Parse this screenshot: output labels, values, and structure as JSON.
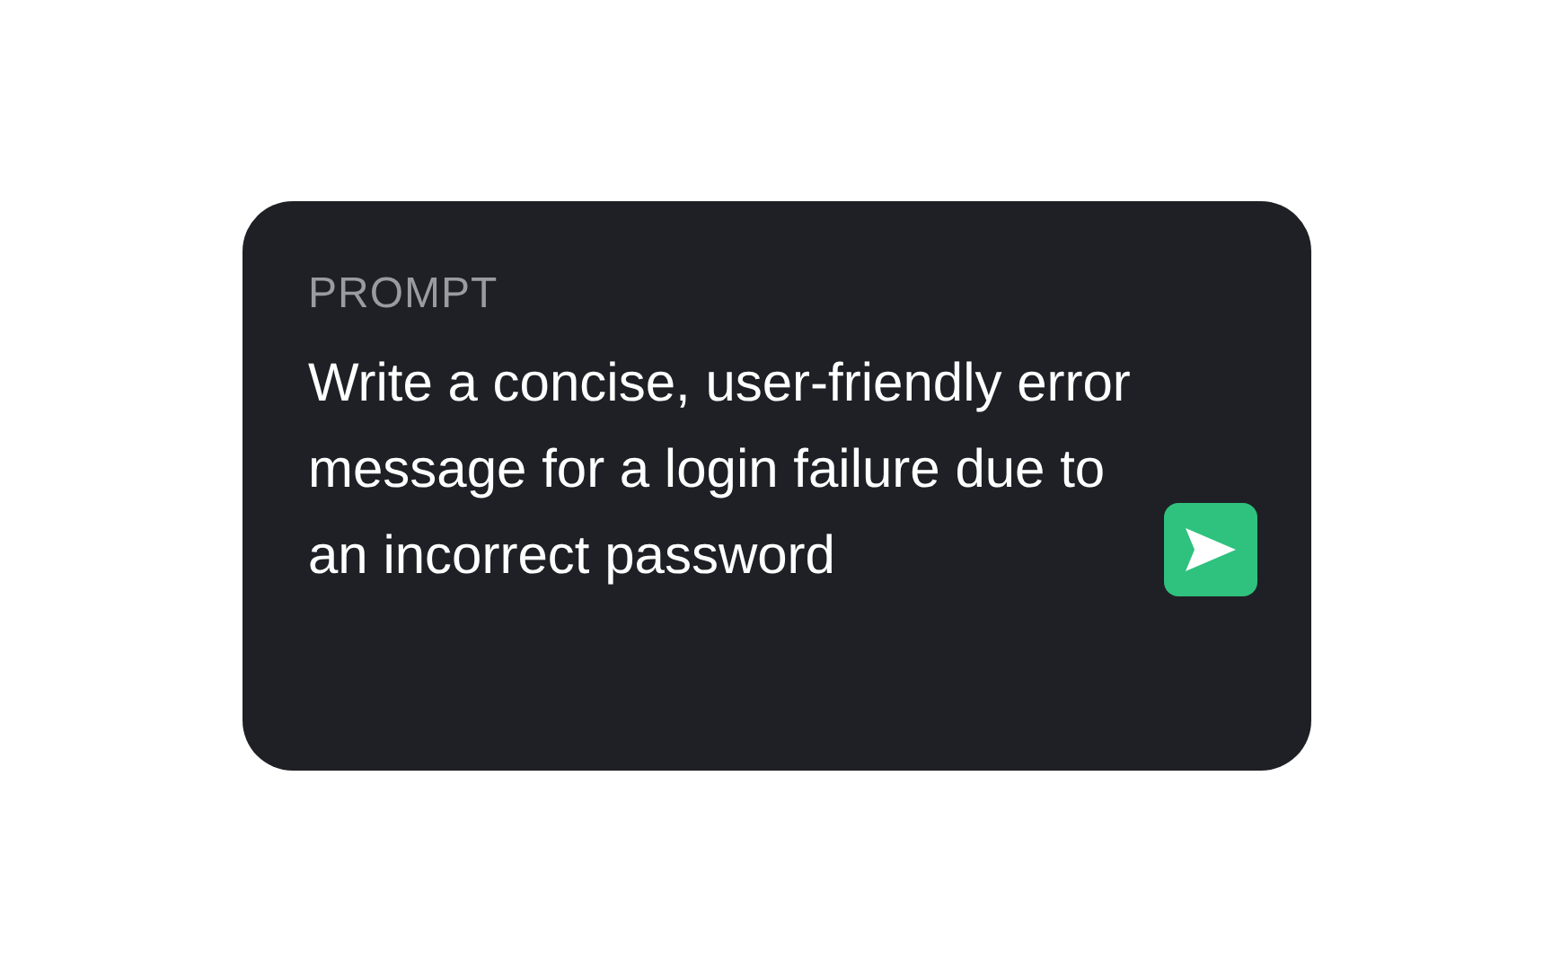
{
  "card": {
    "label": "PROMPT",
    "text": "Write a concise, user-friendly error message for a login failure due to an incorrect password"
  }
}
